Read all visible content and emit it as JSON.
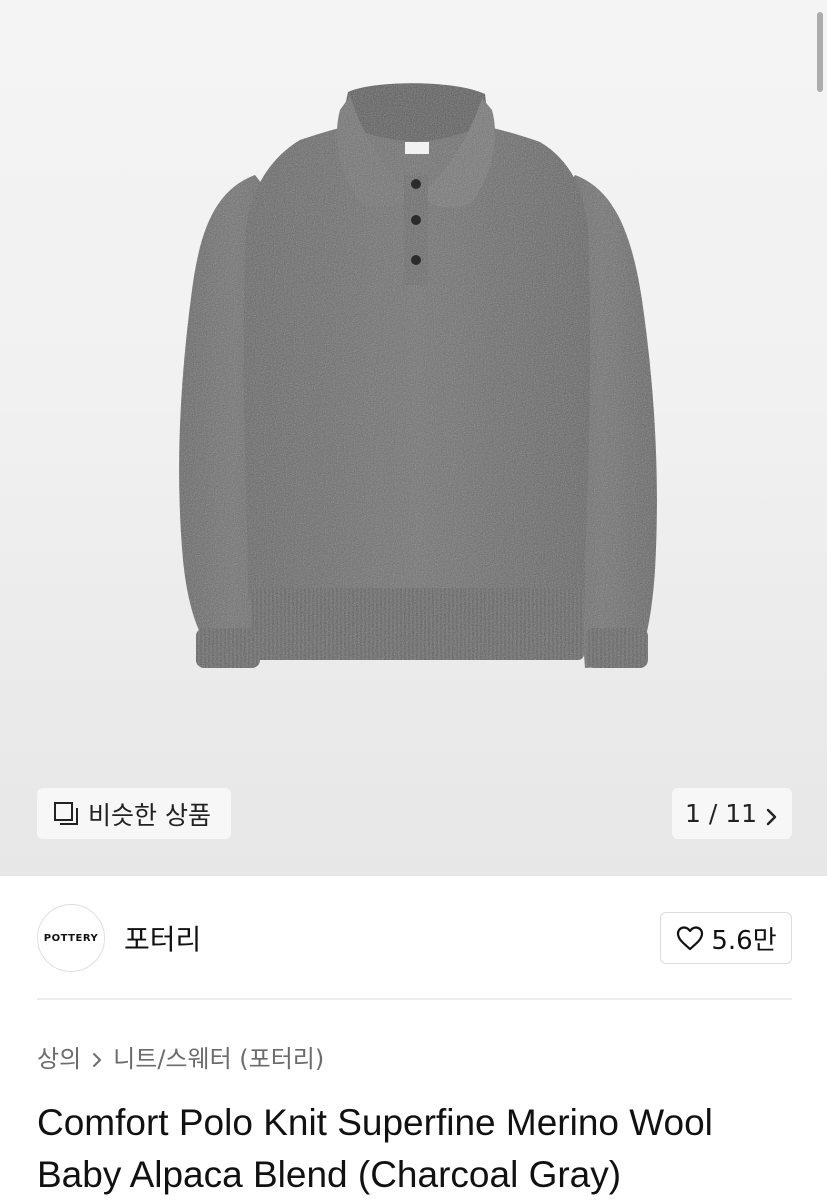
{
  "hero": {
    "image_alt": "Charcoal gray polo knit sweater",
    "similar_label": "비슷한 상품",
    "similar_icon": "similar-items-icon",
    "pager_text": "1 / 11",
    "pager_icon": "chevron-right-icon"
  },
  "shop": {
    "logo_text": "POTTERY",
    "name": "포터리",
    "likes": "5.6만",
    "like_icon": "heart-icon"
  },
  "breadcrumb": {
    "category": "상의",
    "subcategory": "니트/스웨터 (포터리)"
  },
  "product": {
    "title_line1": "Comfort Polo Knit Superfine Merino Wool",
    "title_line2": "Baby Alpaca Blend (Charcoal Gray)"
  },
  "colors": {
    "sweater": "#6e6e6e",
    "hero_bg": "#f1f1f1",
    "text_primary": "#111111",
    "text_secondary": "#6b6b6b"
  }
}
